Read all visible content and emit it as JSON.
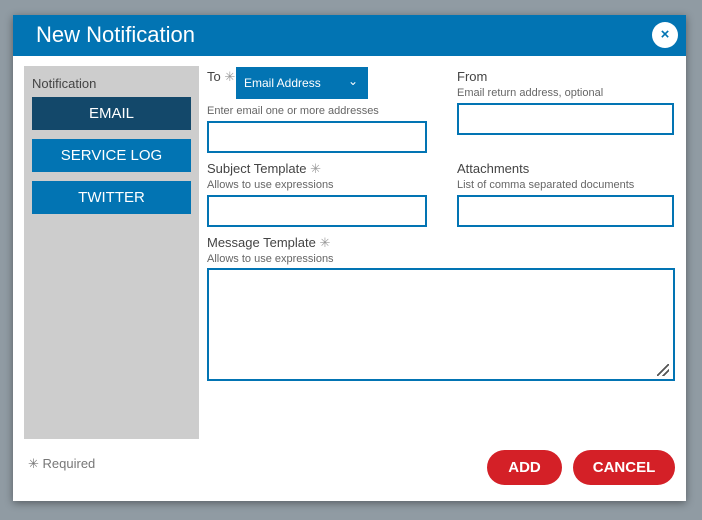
{
  "dialog": {
    "title": "New Notification",
    "close": "×"
  },
  "sidebar": {
    "label": "Notification",
    "items": [
      {
        "label": "EMAIL"
      },
      {
        "label": "SERVICE LOG"
      },
      {
        "label": "TWITTER"
      }
    ]
  },
  "form": {
    "to": {
      "label": "To",
      "required": "✳",
      "dropdown": "Email Address",
      "chevron": "⌄",
      "hint": "Enter email one or more addresses",
      "value": ""
    },
    "from": {
      "label": "From",
      "hint": "Email return address, optional",
      "value": ""
    },
    "subject": {
      "label": "Subject Template",
      "required": "✳",
      "hint": "Allows to use expressions",
      "value": ""
    },
    "attachments": {
      "label": "Attachments",
      "hint": "List of comma separated documents",
      "value": ""
    },
    "message": {
      "label": "Message Template",
      "required": "✳",
      "hint": "Allows to use expressions",
      "value": ""
    }
  },
  "footer": {
    "required_mark": "✳",
    "required_text": "Required",
    "add": "ADD",
    "cancel": "CANCEL"
  }
}
